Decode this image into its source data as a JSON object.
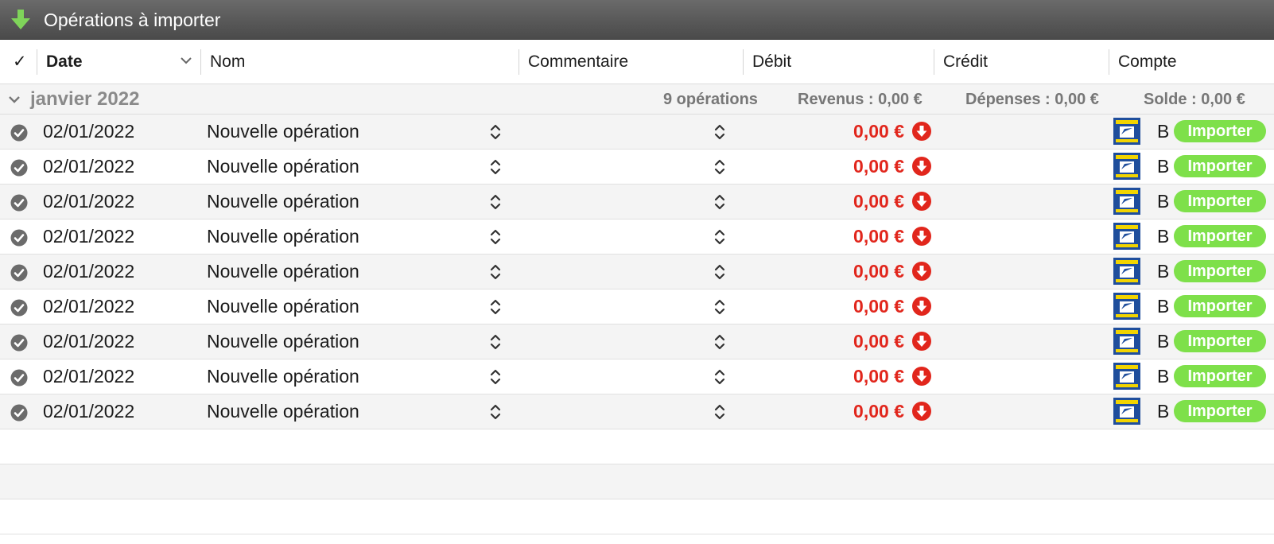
{
  "window": {
    "title": "Opérations à importer",
    "title_icon": "download-arrow-icon"
  },
  "columns": {
    "check": "✓",
    "date": "Date",
    "nom": "Nom",
    "commentaire": "Commentaire",
    "debit": "Débit",
    "credit": "Crédit",
    "compte": "Compte"
  },
  "group": {
    "month": "janvier 2022",
    "count": "9 opérations",
    "revenus": "Revenus : 0,00 €",
    "depenses": "Dépenses : 0,00 €",
    "solde": "Solde : 0,00 €"
  },
  "rows": [
    {
      "date": "02/01/2022",
      "nom": "Nouvelle opération",
      "debit": "0,00 €",
      "compte": "B",
      "action": "Importer"
    },
    {
      "date": "02/01/2022",
      "nom": "Nouvelle opération",
      "debit": "0,00 €",
      "compte": "B",
      "action": "Importer"
    },
    {
      "date": "02/01/2022",
      "nom": "Nouvelle opération",
      "debit": "0,00 €",
      "compte": "B",
      "action": "Importer"
    },
    {
      "date": "02/01/2022",
      "nom": "Nouvelle opération",
      "debit": "0,00 €",
      "compte": "B",
      "action": "Importer"
    },
    {
      "date": "02/01/2022",
      "nom": "Nouvelle opération",
      "debit": "0,00 €",
      "compte": "B",
      "action": "Importer"
    },
    {
      "date": "02/01/2022",
      "nom": "Nouvelle opération",
      "debit": "0,00 €",
      "compte": "B",
      "action": "Importer"
    },
    {
      "date": "02/01/2022",
      "nom": "Nouvelle opération",
      "debit": "0,00 €",
      "compte": "B",
      "action": "Importer"
    },
    {
      "date": "02/01/2022",
      "nom": "Nouvelle opération",
      "debit": "0,00 €",
      "compte": "B",
      "action": "Importer"
    },
    {
      "date": "02/01/2022",
      "nom": "Nouvelle opération",
      "debit": "0,00 €",
      "compte": "B",
      "action": "Importer"
    }
  ],
  "colors": {
    "debit": "#e1261c",
    "importer_button": "#7ee04a",
    "title_arrow": "#7fd45a",
    "bank_logo": "#1f4e9c"
  }
}
